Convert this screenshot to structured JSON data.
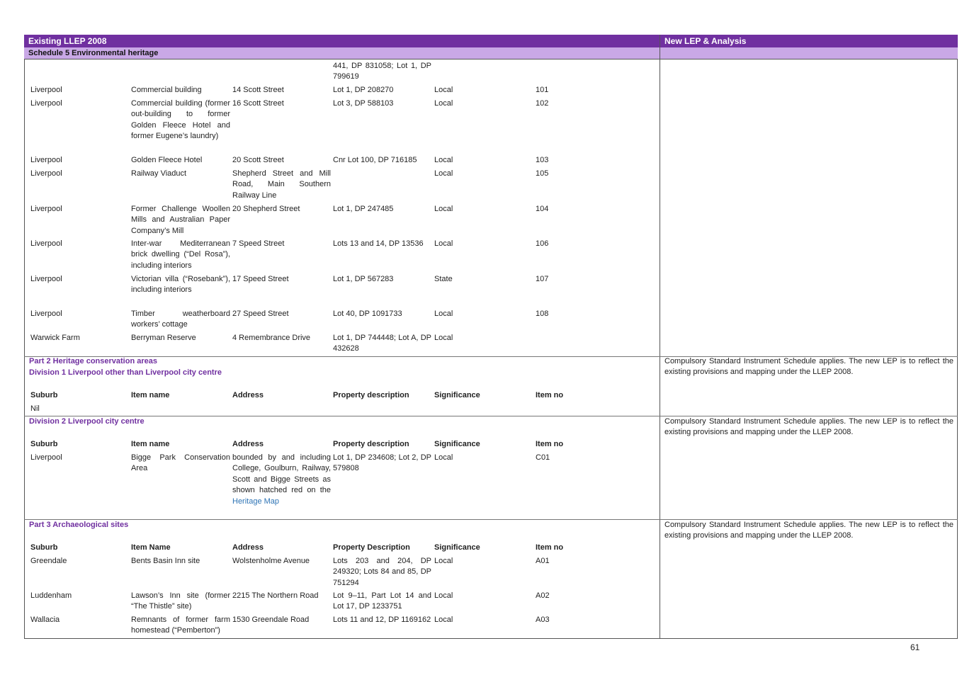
{
  "header": {
    "left_title": "Existing LLEP 2008",
    "right_title": "New LEP & Analysis",
    "schedule_title": "Schedule 5 Environmental heritage"
  },
  "part1": {
    "continued_desc": "441, DP 831058; Lot 1, DP 799619",
    "rows": [
      {
        "suburb": "Liverpool",
        "item": "Commercial building",
        "address": "14 Scott Street",
        "desc": "Lot 1, DP 208270",
        "sig": "Local",
        "no": "101"
      },
      {
        "suburb": "Liverpool",
        "item": "Commercial building (former out-building to former Golden Fleece Hotel and former Eugene’s laundry)",
        "address": "16 Scott Street",
        "desc": "Lot 3, DP 588103",
        "sig": "Local",
        "no": "102"
      },
      {
        "suburb": "Liverpool",
        "item": "Golden Fleece Hotel",
        "address": "20 Scott Street",
        "desc": "Cnr Lot 100, DP 716185",
        "sig": "Local",
        "no": "103"
      },
      {
        "suburb": "Liverpool",
        "item": "Railway Viaduct",
        "address": "Shepherd Street and Mill Road, Main Southern Railway Line",
        "desc": "",
        "sig": "Local",
        "no": "105"
      },
      {
        "suburb": "Liverpool",
        "item": "Former Challenge Woollen Mills and Australian Paper Company’s Mill",
        "address": "20 Shepherd Street",
        "desc": "Lot 1, DP 247485",
        "sig": "Local",
        "no": "104"
      },
      {
        "suburb": "Liverpool",
        "item": "Inter-war Mediterranean brick dwelling (“Del Rosa”), including interiors",
        "address": "7 Speed Street",
        "desc": "Lots 13 and 14, DP 13536",
        "sig": "Local",
        "no": "106"
      },
      {
        "suburb": "Liverpool",
        "item": "Victorian villa (“Rosebank”), including interiors",
        "address": "17 Speed Street",
        "desc": "Lot 1, DP 567283",
        "sig": "State",
        "no": "107"
      },
      {
        "suburb": "Liverpool",
        "item": "Timber weatherboard workers’ cottage",
        "address": "27 Speed Street",
        "desc": "Lot 40, DP 1091733",
        "sig": "Local",
        "no": "108"
      },
      {
        "suburb": "Warwick Farm",
        "item": "Berryman Reserve",
        "address": "4 Remembrance Drive",
        "desc": "Lot 1, DP 744448; Lot A, DP 432628",
        "sig": "Local",
        "no": ""
      }
    ]
  },
  "part2": {
    "title": "Part 2 Heritage conservation areas",
    "div1_title": "Division 1 Liverpool other than Liverpool city centre",
    "headings": {
      "suburb": "Suburb",
      "item": "Item name",
      "address": "Address",
      "desc": "Property description",
      "sig": "Significance",
      "no": "Item no"
    },
    "div1_value": "Nil",
    "div2_title": "Division 2 Liverpool city centre",
    "div2_row": {
      "suburb": "Liverpool",
      "item": "Bigge Park Conservation Area",
      "address": "bounded by and including College, Goulburn, Railway, Scott and Bigge Streets as shown hatched red on the",
      "address_link": "Heritage Map",
      "desc": "Lot 1, DP 234608; Lot 2, DP 579808",
      "sig": "Local",
      "no": "C01"
    },
    "analysis": "Compulsory Standard Instrument Schedule applies. The new LEP is to reflect the existing provisions and mapping under the LLEP 2008."
  },
  "part3": {
    "title": "Part 3 Archaeological sites",
    "headings": {
      "suburb": "Suburb",
      "item": "Item Name",
      "address": "Address",
      "desc": "Property Description",
      "sig": "Significance",
      "no": "Item no"
    },
    "rows": [
      {
        "suburb": "Greendale",
        "item": "Bents Basin Inn site",
        "address": "Wolstenholme Avenue",
        "desc": "Lots 203 and 204, DP 249320; Lots 84 and 85, DP 751294",
        "sig": "Local",
        "no": "A01"
      },
      {
        "suburb": "Luddenham",
        "item": "Lawson’s Inn site (former “The Thistle” site)",
        "address": "2215 The Northern Road",
        "desc": "Lot 9–11, Part Lot 14 and Lot 17, DP 1233751",
        "sig": "Local",
        "no": "A02"
      },
      {
        "suburb": "Wallacia",
        "item": "Remnants of former farm homestead (“Pemberton”)",
        "address": "1530 Greendale Road",
        "desc": "Lots 11 and 12, DP 1169162",
        "sig": "Local",
        "no": "A03"
      }
    ],
    "analysis": "Compulsory Standard Instrument Schedule applies. The new LEP is to reflect the existing provisions and mapping under the LLEP 2008."
  },
  "page_number": "61"
}
